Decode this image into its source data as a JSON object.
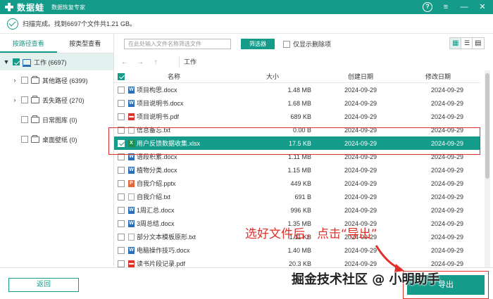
{
  "titlebar": {
    "app_name": "数据蛙",
    "subtitle": "数据恢复专家",
    "icons": [
      "help-icon",
      "menu-icon",
      "minimize-icon",
      "close-icon"
    ],
    "help_glyph": "?",
    "menu_glyph": "≡",
    "min_glyph": "—",
    "close_glyph": "✕"
  },
  "status": {
    "text": "扫描完成。找到6697个文件共1.21 GB。"
  },
  "sidebar": {
    "tabs": [
      {
        "label": "按路径查看",
        "active": true
      },
      {
        "label": "按类型查看",
        "active": false
      }
    ],
    "root": {
      "arrow": "▼",
      "label": "工作 (6697)"
    },
    "items": [
      {
        "arrow": "›",
        "label": "其他路径 (6399)"
      },
      {
        "arrow": "›",
        "label": "丢失路径 (270)"
      },
      {
        "arrow": "",
        "label": "日常图库 (0)"
      },
      {
        "arrow": "",
        "label": "桌面壁纸 (0)"
      }
    ]
  },
  "toolbar": {
    "search_placeholder": "在此处输入文件名称筛选文件",
    "filter_label": "筛选器",
    "only_deleted_label": "仅显示删除项"
  },
  "pathbar": {
    "back_glyph": "←",
    "forward_glyph": "→",
    "up_glyph": "↑",
    "path": "工作"
  },
  "table": {
    "headers": {
      "name": "名称",
      "size": "大小",
      "created": "创建日期",
      "modified": "修改日期"
    },
    "rows": [
      {
        "name": "项目构思.docx",
        "type": "docx",
        "size": "1.48 MB",
        "created": "2024-09-29",
        "modified": "2024-09-29",
        "selected": false
      },
      {
        "name": "项目说明书.docx",
        "type": "docx",
        "size": "1.68 MB",
        "created": "2024-09-29",
        "modified": "2024-09-29",
        "selected": false
      },
      {
        "name": "项目说明书.pdf",
        "type": "pdf",
        "size": "689 KB",
        "created": "2024-09-29",
        "modified": "2024-09-29",
        "selected": false
      },
      {
        "name": "信息备忘.txt",
        "type": "txt",
        "size": "0.00  B",
        "created": "2024-09-29",
        "modified": "2024-09-29",
        "selected": false
      },
      {
        "name": "用户反馈数据收集.xlsx",
        "type": "xlsx",
        "size": "17.5 KB",
        "created": "2024-09-29",
        "modified": "2024-09-29",
        "selected": true
      },
      {
        "name": "语段积累.docx",
        "type": "docx",
        "size": "1.11 MB",
        "created": "2024-09-29",
        "modified": "2024-09-29",
        "selected": false
      },
      {
        "name": "植物分类.docx",
        "type": "docx",
        "size": "1.15 MB",
        "created": "2024-09-29",
        "modified": "2024-09-29",
        "selected": false
      },
      {
        "name": "自我介绍.pptx",
        "type": "pptx",
        "size": "449 KB",
        "created": "2024-09-29",
        "modified": "2024-09-29",
        "selected": false
      },
      {
        "name": "自我介绍.txt",
        "type": "txt",
        "size": "691  B",
        "created": "2024-09-29",
        "modified": "2024-09-29",
        "selected": false
      },
      {
        "name": "1周汇总.docx",
        "type": "docx",
        "size": "996 KB",
        "created": "2024-09-29",
        "modified": "2024-09-29",
        "selected": false
      },
      {
        "name": "3周总结.docx",
        "type": "docx",
        "size": "1.35 MB",
        "created": "2024-09-29",
        "modified": "2024-09-29",
        "selected": false
      },
      {
        "name": "部分文本模板原形.txt",
        "type": "txt",
        "size": "1.11 KB",
        "created": "2024-09-29",
        "modified": "2024-09-29",
        "selected": false
      },
      {
        "name": "电脑操作技巧.docx",
        "type": "docx",
        "size": "1.40 MB",
        "created": "2024-09-29",
        "modified": "2024-09-29",
        "selected": false
      },
      {
        "name": "读书片段记录.pdf",
        "type": "pdf",
        "size": "20.3 KB",
        "created": "2024-09-29",
        "modified": "2024-09-29",
        "selected": false
      }
    ]
  },
  "annotation": {
    "text": "选好文件后，点击“导出”"
  },
  "bottom": {
    "back_label": "返回",
    "export_label": "导出"
  },
  "watermark": {
    "text": "掘金技术社区 @ 小明助手"
  },
  "colors": {
    "accent": "#159b8a",
    "highlight": "#e0302a"
  }
}
